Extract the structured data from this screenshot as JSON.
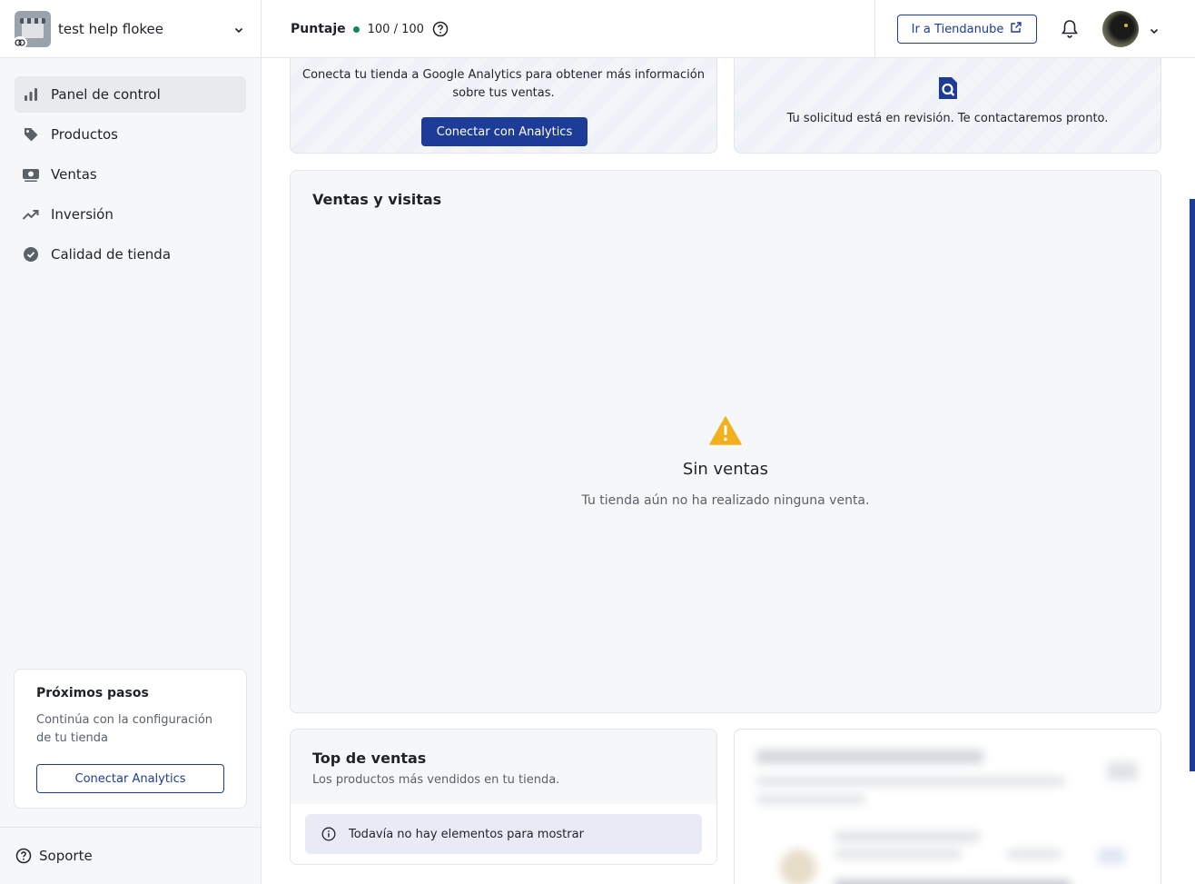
{
  "store": {
    "name": "test help flokee"
  },
  "nav": {
    "items": [
      {
        "label": "Panel de control",
        "icon": "bar-chart-icon",
        "active": true
      },
      {
        "label": "Productos",
        "icon": "tag-icon",
        "active": false
      },
      {
        "label": "Ventas",
        "icon": "money-icon",
        "active": false
      },
      {
        "label": "Inversión",
        "icon": "trend-up-icon",
        "active": false
      },
      {
        "label": "Calidad de tienda",
        "icon": "check-badge-icon",
        "active": false
      }
    ]
  },
  "next_steps": {
    "title": "Próximos pasos",
    "text": "Continúa con la configuración de tu tienda",
    "button": "Conectar Analytics"
  },
  "support": {
    "label": "Soporte"
  },
  "topbar": {
    "score_label": "Puntaje",
    "score_value": "100 / 100",
    "score_color": "#12855a",
    "store_link": "Ir a Tiendanube"
  },
  "analytics_card": {
    "text": "Conecta tu tienda a Google Analytics para obtener más información sobre tus ventas.",
    "button": "Conectar con Analytics"
  },
  "review_card": {
    "text": "Tu solicitud está en revisión. Te contactaremos pronto."
  },
  "sales_card": {
    "title": "Ventas y visitas",
    "empty_title": "Sin ventas",
    "empty_text": "Tu tienda aún no ha realizado ninguna venta."
  },
  "top_sales": {
    "title": "Top de ventas",
    "subtitle": "Los productos más vendidos en tu tienda.",
    "empty_text": "Todavía no hay elementos para mostrar"
  },
  "colors": {
    "primary": "#1d3c98",
    "warning": "#f2b01e"
  }
}
